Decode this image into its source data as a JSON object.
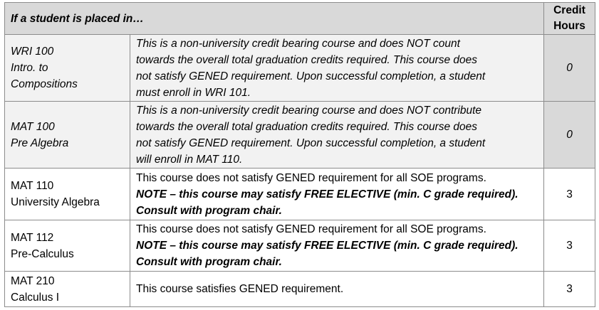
{
  "header": {
    "course_col": "If a student is placed in…",
    "credit_col_line1": "Credit",
    "credit_col_line2": "Hours"
  },
  "rows": [
    {
      "course_line1": "WRI 100",
      "course_line2": "Intro. to",
      "course_line3": "Compositions",
      "desc_lines": [
        "This is a non-university credit bearing course and does NOT count",
        "towards the overall total graduation credits required. This course does",
        "not satisfy GENED requirement. Upon successful completion, a student",
        "must enroll in WRI 101."
      ],
      "credit": "0"
    },
    {
      "course_line1": "MAT 100",
      "course_line2": "Pre Algebra",
      "desc_lines": [
        "This is a non-university credit bearing course and does NOT contribute",
        "towards the overall total graduation credits required. This course does",
        "not satisfy GENED requirement. Upon successful completion, a student",
        "will enroll in MAT 110."
      ],
      "credit": "0"
    },
    {
      "course_line1": "MAT 110",
      "course_line2": "University Algebra",
      "desc_line1": "This course does not satisfy GENED requirement for all SOE programs.",
      "note_line1": "NOTE – this course may satisfy FREE ELECTIVE (min. C grade required).",
      "note_line2": "Consult with program chair.",
      "credit": "3"
    },
    {
      "course_line1": "MAT 112",
      "course_line2": "Pre-Calculus",
      "desc_line1": "This course does not satisfy GENED requirement for all SOE programs.",
      "note_line1": "NOTE – this course may satisfy FREE ELECTIVE (min. C grade required).",
      "note_line2": "Consult with program chair.",
      "credit": "3"
    },
    {
      "course_line1": "MAT 210",
      "course_line2": "Calculus I",
      "desc_line1": "This course satisfies GENED requirement.",
      "credit": "3"
    }
  ]
}
